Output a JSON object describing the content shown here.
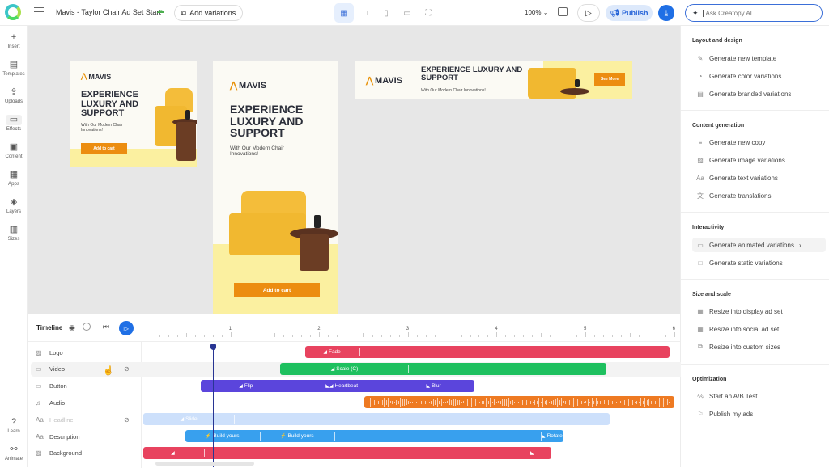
{
  "topbar": {
    "title": "Mavis - Taylor Chair Ad Set Start",
    "add_variations": "Add variations",
    "zoom": "100%",
    "publish": "Publish",
    "ai_placeholder": "Ask Creatopy AI..."
  },
  "leftbar": {
    "items": [
      {
        "label": "Insert",
        "icon": "+"
      },
      {
        "label": "Templates",
        "icon": "▤"
      },
      {
        "label": "Uploads",
        "icon": "⇪"
      },
      {
        "label": "Effects",
        "icon": "▭"
      },
      {
        "label": "Content",
        "icon": "▣"
      },
      {
        "label": "Apps",
        "icon": "▦"
      },
      {
        "label": "Layers",
        "icon": "◈"
      },
      {
        "label": "Sizes",
        "icon": "▥"
      }
    ],
    "bottom": [
      {
        "label": "Learn",
        "icon": "?"
      },
      {
        "label": "Animate",
        "icon": "⚯"
      }
    ]
  },
  "ads": {
    "brand": "MAVIS",
    "headline": "EXPERIENCE LUXURY AND SUPPORT",
    "sub": "With Our Modern Chair Innovations!",
    "cta_cart": "Add to cart",
    "cta_more": "See More"
  },
  "rightpanel": {
    "sections": [
      {
        "title": "Layout and design",
        "items": [
          {
            "label": "Generate new template",
            "icon": "✎"
          },
          {
            "label": "Generate color variations",
            "icon": "◔"
          },
          {
            "label": "Generate branded variations",
            "icon": "▤"
          }
        ]
      },
      {
        "title": "Content generation",
        "items": [
          {
            "label": "Generate new copy",
            "icon": "≡"
          },
          {
            "label": "Generate image variations",
            "icon": "▨"
          },
          {
            "label": "Generate text variations",
            "icon": "Aa"
          },
          {
            "label": "Generate translations",
            "icon": "文"
          }
        ]
      },
      {
        "title": "Interactivity",
        "items": [
          {
            "label": "Generate animated variations",
            "icon": "▭"
          },
          {
            "label": "Generate static variations",
            "icon": "□"
          }
        ]
      },
      {
        "title": "Size and scale",
        "items": [
          {
            "label": "Resize into display ad set",
            "icon": "▦"
          },
          {
            "label": "Resize into social ad set",
            "icon": "▦"
          },
          {
            "label": "Resize into custom sizes",
            "icon": "⧉"
          }
        ]
      },
      {
        "title": "Optimization",
        "items": [
          {
            "label": "Start an A/B Test",
            "icon": "⅍"
          },
          {
            "label": "Publish my ads",
            "icon": "⚐"
          }
        ]
      }
    ]
  },
  "timeline": {
    "title": "Timeline",
    "ruler": [
      "1",
      "2",
      "3",
      "4",
      "5",
      "6"
    ],
    "playhead_seconds": 0.8,
    "layers": [
      {
        "label": "Logo",
        "icon": "▨"
      },
      {
        "label": "Video",
        "icon": "▭"
      },
      {
        "label": "Button",
        "icon": "▭"
      },
      {
        "label": "Audio",
        "icon": "♫"
      },
      {
        "label": "Headline",
        "icon": "Aa"
      },
      {
        "label": "Description",
        "icon": "Aa"
      },
      {
        "label": "Background",
        "icon": "▨"
      }
    ],
    "tracks": [
      {
        "layer": "Logo",
        "color": "#e8435f",
        "start": 1.84,
        "end": 5.95,
        "segments": [
          {
            "label": "Fade",
            "icon": "◢",
            "start": 1.84,
            "end": 2.45
          }
        ]
      },
      {
        "layer": "Video",
        "color": "#1ec05f",
        "start": 1.56,
        "end": 5.24,
        "segments": [
          {
            "label": "Scale (C)",
            "icon": "◢",
            "start": 1.57,
            "end": 3.0
          }
        ]
      },
      {
        "layer": "Button",
        "color": "#5b45dc",
        "start": 0.67,
        "end": 3.75,
        "segments": [
          {
            "label": "Flip",
            "icon": "◢",
            "start": 0.67,
            "end": 1.68
          },
          {
            "label": "Heartbeat",
            "icon": "◣◢",
            "start": 1.68,
            "end": 2.83
          },
          {
            "label": "Blur",
            "icon": "◣",
            "start": 2.83,
            "end": 3.75
          }
        ]
      },
      {
        "layer": "Audio",
        "color": "#ee7a22",
        "start": 2.51,
        "end": 6.0,
        "segments": []
      },
      {
        "layer": "Headline",
        "color": "#cde0fb",
        "start": 0.02,
        "end": 5.27,
        "segments": [
          {
            "label": "Slide",
            "icon": "◢",
            "start": 0.02,
            "end": 1.04
          }
        ]
      },
      {
        "layer": "Description",
        "color": "#38a0ee",
        "start": 0.49,
        "end": 4.75,
        "segments": [
          {
            "label": "Build yours",
            "icon": "⚡",
            "start": 0.49,
            "end": 1.33
          },
          {
            "label": "Build yours",
            "icon": "⚡",
            "start": 1.33,
            "end": 2.17
          },
          {
            "label": "",
            "icon": "",
            "start": 2.17,
            "end": 4.5
          },
          {
            "label": "Rotate",
            "icon": "◣",
            "start": 4.5,
            "end": 4.75
          }
        ]
      },
      {
        "layer": "Background",
        "color": "#e8435f",
        "start": 0.02,
        "end": 4.62,
        "segments": [
          {
            "label": "",
            "icon": "◢",
            "start": 0.02,
            "end": 0.7
          },
          {
            "label": "",
            "icon": "◣",
            "start": 4.2,
            "end": 4.62
          }
        ]
      }
    ]
  }
}
